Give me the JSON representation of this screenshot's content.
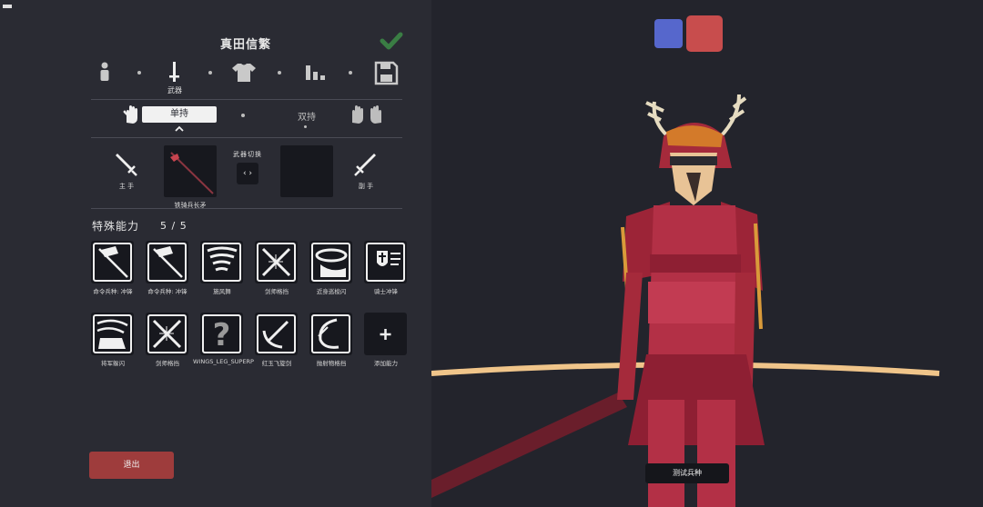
{
  "unit": {
    "name": "真田信繁"
  },
  "tabs": [
    {
      "id": "unit",
      "icon": "person-icon",
      "label": ""
    },
    {
      "id": "weapons",
      "icon": "sword-icon",
      "label": "武器"
    },
    {
      "id": "clothing",
      "icon": "shirt-icon",
      "label": ""
    },
    {
      "id": "stats",
      "icon": "bar-stats-icon",
      "label": ""
    },
    {
      "id": "save",
      "icon": "floppy-save-icon",
      "label": ""
    }
  ],
  "grip": {
    "single_label": "单持",
    "dual_label": "双持"
  },
  "weapons": {
    "main_hand_label": "主 手",
    "off_hand_label": "副 手",
    "swap_label": "武器切换",
    "swap_button": "‹ ›",
    "main_weapon_name": "铁骑兵长矛"
  },
  "abilities": {
    "title": "特殊能力",
    "count": "5 / 5",
    "items": [
      {
        "label": "命令兵种: 冲锋",
        "icon": "flag-command-icon"
      },
      {
        "label": "命令兵种: 冲锋",
        "icon": "flag-command-icon"
      },
      {
        "label": "施风舞",
        "icon": "tornado-icon"
      },
      {
        "label": "剑师格挡",
        "icon": "crossed-swords-icon"
      },
      {
        "label": "近身巡梭闪",
        "icon": "dash-ring-icon"
      },
      {
        "label": "骑士冲锋",
        "icon": "shield-charge-icon"
      },
      {
        "label": "将军躲闪",
        "icon": "general-dodge-icon"
      },
      {
        "label": "剑师格挡",
        "icon": "crossed-swords-icon"
      },
      {
        "label": "WINGS_LEG_SUPERP",
        "icon": "question-mark-icon"
      },
      {
        "label": "红玉飞旋剑",
        "icon": "spinning-blade-icon"
      },
      {
        "label": "抛射物格挡",
        "icon": "projectile-block-icon"
      },
      {
        "label": "添加能力",
        "icon": "plus-icon"
      }
    ]
  },
  "buttons": {
    "exit": "退出",
    "test_unit": "测试兵种"
  },
  "colors": {
    "team_blue": "#5667cc",
    "team_red": "#c84d4d",
    "accent_green": "#3aa34a"
  }
}
